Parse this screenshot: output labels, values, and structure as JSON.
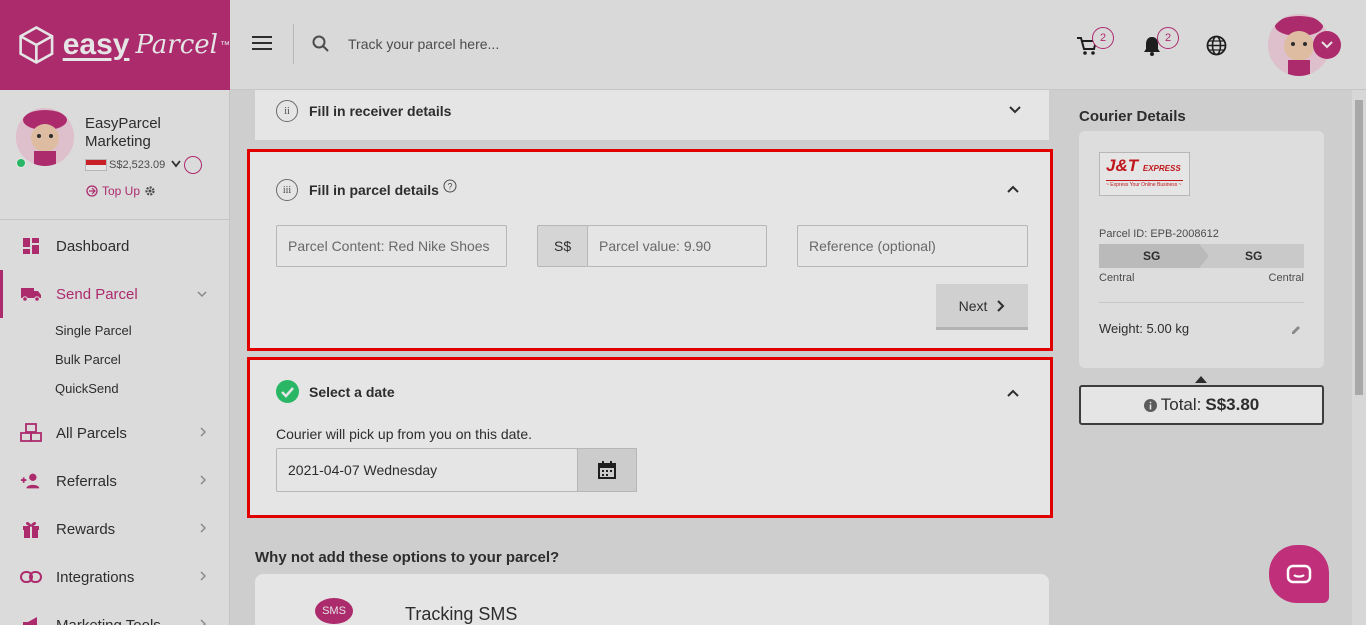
{
  "header": {
    "logo_word": "easy",
    "logo_script": "Parcel",
    "logo_tm": "™",
    "search_placeholder": "Track your parcel here...",
    "cart_count": "2",
    "notif_count": "2"
  },
  "profile": {
    "name": "EasyParcel Marketing",
    "balance": "S$2,523.09",
    "topup_label": "Top Up"
  },
  "nav": {
    "dashboard": "Dashboard",
    "send_parcel": "Send Parcel",
    "single_parcel": "Single Parcel",
    "bulk_parcel": "Bulk Parcel",
    "quicksend": "QuickSend",
    "all_parcels": "All Parcels",
    "referrals": "Referrals",
    "rewards": "Rewards",
    "integrations": "Integrations",
    "marketing_tools": "Marketing Tools"
  },
  "steps": {
    "receiver": {
      "num": "ii",
      "title": "Fill in receiver details"
    },
    "parcel": {
      "num": "iii",
      "title": "Fill in parcel details",
      "content_placeholder": "Parcel Content: Red Nike Shoes",
      "currency": "S$",
      "value_placeholder": "Parcel value: 9.90",
      "reference_placeholder": "Reference (optional)",
      "next_label": "Next"
    },
    "date": {
      "title": "Select a date",
      "desc": "Courier will pick up from you on this date.",
      "value": "2021-04-07 Wednesday"
    }
  },
  "options": {
    "heading": "Why not add these options to your parcel?",
    "sms_badge": "SMS",
    "sms_title": "Tracking SMS"
  },
  "courier": {
    "heading": "Courier Details",
    "logo_text": "J&T",
    "logo_express": "EXPRESS",
    "logo_tagline": "~ Express Your Online Business ~",
    "parcel_id": "Parcel ID: EPB-2008612",
    "from_country": "SG",
    "to_country": "SG",
    "from_region": "Central",
    "to_region": "Central",
    "weight": "Weight: 5.00 kg",
    "total_label": "Total:",
    "total_value": "S$3.80"
  },
  "colors": {
    "brand": "#c0307a",
    "highlight": "#e00000",
    "success": "#2ecc71"
  }
}
